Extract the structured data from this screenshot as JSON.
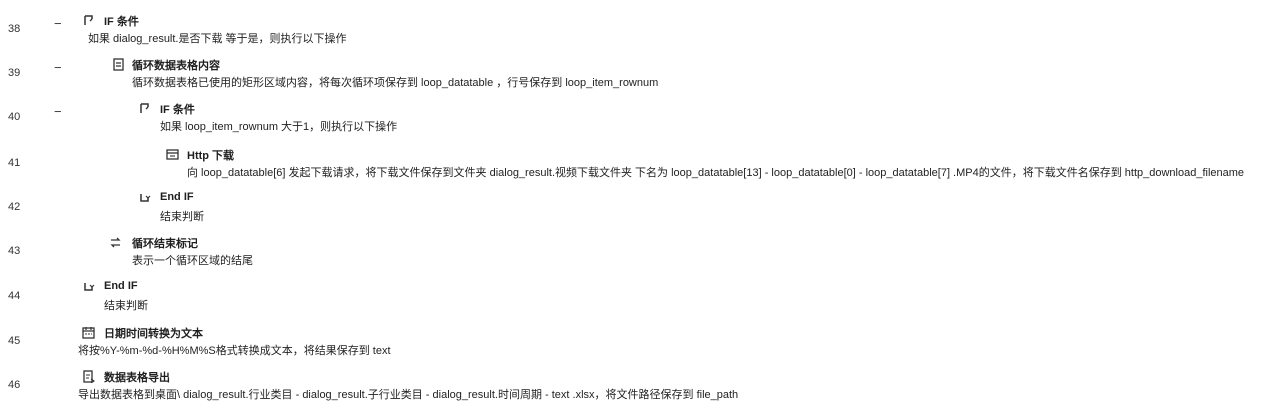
{
  "steps": [
    {
      "line": "38",
      "title": "IF 条件",
      "desc": "如果  dialog_result.是否下载  等于是，则执行以下操作"
    },
    {
      "line": "39",
      "title": "循环数据表格内容",
      "desc": "循环数据表格已使用的矩形区域内容，将每次循环项保存到  loop_datatable ，行号保存到  loop_item_rownum"
    },
    {
      "line": "40",
      "title": "IF 条件",
      "desc": "如果  loop_item_rownum  大于1，则执行以下操作"
    },
    {
      "line": "41",
      "title": "Http 下载",
      "desc": "向  loop_datatable[6]  发起下载请求，将下载文件保存到文件夹  dialog_result.视频下载文件夹  下名为  loop_datatable[13]  -  loop_datatable[0]  -  loop_datatable[7]  .MP4的文件，将下载文件名保存到  http_download_filename"
    },
    {
      "line": "42",
      "title": "End IF",
      "desc": "结束判断"
    },
    {
      "line": "43",
      "title": "循环结束标记",
      "desc": "表示一个循环区域的结尾"
    },
    {
      "line": "44",
      "title": "End IF",
      "desc": "结束判断"
    },
    {
      "line": "45",
      "title": "日期时间转换为文本",
      "desc": "将按%Y-%m-%d-%H%M%S格式转换成文本，将结果保存到  text"
    },
    {
      "line": "46",
      "title": "数据表格导出",
      "desc": "导出数据表格到桌面\\  dialog_result.行业类目  -  dialog_result.子行业类目  -  dialog_result.时间周期  -  text  .xlsx，将文件路径保存到  file_path"
    }
  ],
  "collapse_symbol": "−"
}
